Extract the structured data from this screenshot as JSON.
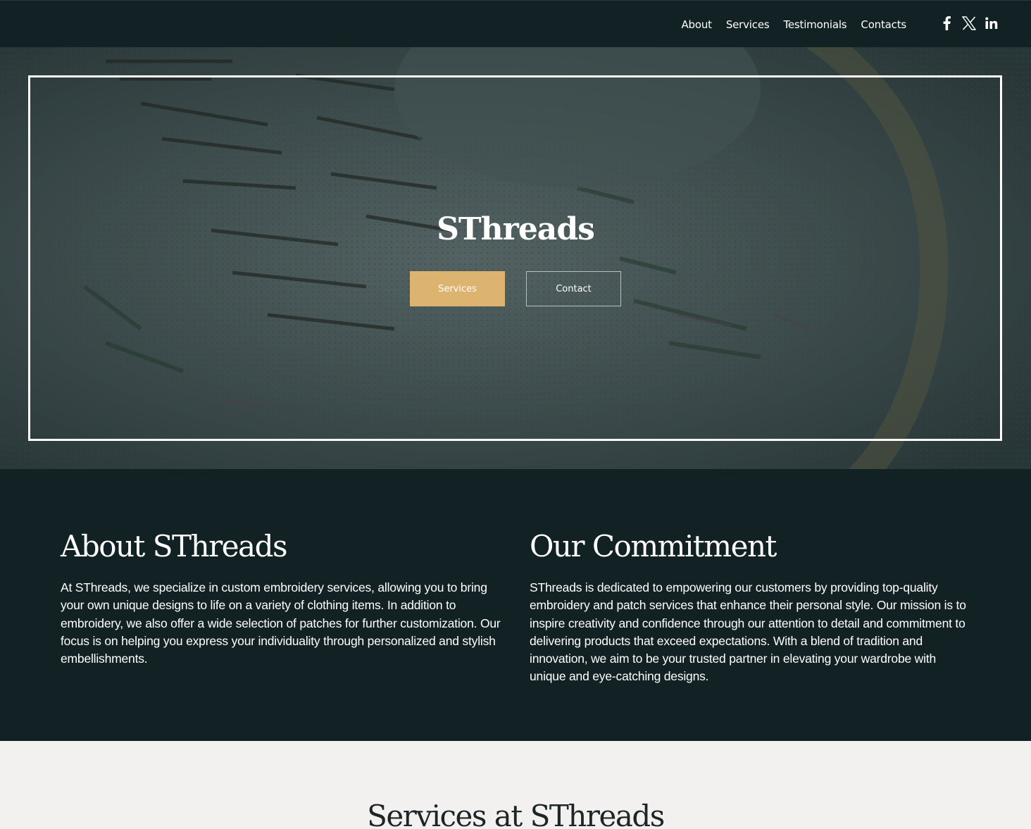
{
  "nav": {
    "links": [
      {
        "label": "About"
      },
      {
        "label": "Services"
      },
      {
        "label": "Testimonials"
      },
      {
        "label": "Contacts"
      }
    ],
    "socials": [
      "facebook-icon",
      "x-icon",
      "linkedin-icon"
    ]
  },
  "hero": {
    "title": "SThreads",
    "primary_button": "Services",
    "secondary_button": "Contact",
    "accent_color": "#ddb46f"
  },
  "about": {
    "left": {
      "heading": "About SThreads",
      "body": "At SThreads, we specialize in custom embroidery services, allowing you to bring your own unique designs to life on a variety of clothing items. In addition to embroidery, we also offer a wide selection of patches for further customization. Our focus is on helping you express your individuality through personalized and stylish embellishments."
    },
    "right": {
      "heading": "Our Commitment",
      "body": "SThreads is dedicated to empowering our customers by providing top-quality embroidery and patch services that enhance their personal style. Our mission is to inspire creativity and confidence through our attention to detail and commitment to delivering products that exceed expectations. With a blend of tradition and innovation, we aim to be your trusted partner in elevating your wardrobe with unique and eye-catching designs."
    }
  },
  "services": {
    "heading": "Services at SThreads"
  },
  "colors": {
    "dark": "#122123",
    "light": "#f2f1ef"
  }
}
